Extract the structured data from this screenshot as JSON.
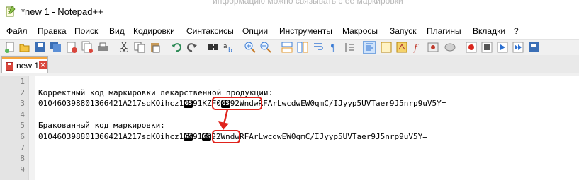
{
  "window": {
    "title": "*new 1 - Notepad++",
    "stray_text": "информацию можно связывать с ее маркировки"
  },
  "menu": [
    "Файл",
    "Правка",
    "Поиск",
    "Вид",
    "Кодировки",
    "Синтаксисы",
    "Опции",
    "Инструменты",
    "Макросы",
    "Запуск",
    "Плагины",
    "Вкладки",
    "?"
  ],
  "toolbar": {
    "icons": [
      "new-file-icon",
      "open-file-icon",
      "save-icon",
      "save-all-icon",
      "close-icon",
      "close-all-icon",
      "print-icon",
      "cut-icon",
      "copy-icon",
      "paste-icon",
      "undo-icon",
      "redo-icon",
      "find-icon",
      "replace-icon",
      "zoom-in-icon",
      "zoom-out-icon",
      "sync-vertical-icon",
      "sync-horizontal-icon",
      "word-wrap-icon",
      "show-all-chars-icon",
      "indent-guide-icon",
      "udl-icon",
      "doc-map-icon",
      "function-list-icon",
      "folder-workspace-icon",
      "monitoring-icon",
      "record-macro-icon",
      "stop-macro-icon",
      "play-macro-icon",
      "run-macro-icon",
      "save-macro-icon"
    ]
  },
  "tabs": [
    {
      "label": "new 1",
      "close": "✕"
    }
  ],
  "editor": {
    "line_numbers": [
      "1",
      "2",
      "3",
      "4",
      "5",
      "6",
      "7",
      "8",
      "9"
    ],
    "gs_label": "GS",
    "lines": {
      "l2": "Корректный код маркировки лекарственной продукции:",
      "l3a": "010460398801366421A217sqKOihcz1",
      "l3b": "91KZF0",
      "l3c": "92WndwRFArLwcdwEW0qmC/IJyyp5UVTaer9J5nrp9uV5Y=",
      "l5": "Бракованный код маркировки:",
      "l6a": "010460398801366421A217sqKOihcz1",
      "l6b": "91",
      "l6c": "92WndwRFArLwcdwEW0qmC/IJyyp5UVTaer9J5nrp9uV5Y="
    }
  },
  "colors": {
    "highlight": "#e0231c",
    "tab_accent": "#f7a63d"
  }
}
